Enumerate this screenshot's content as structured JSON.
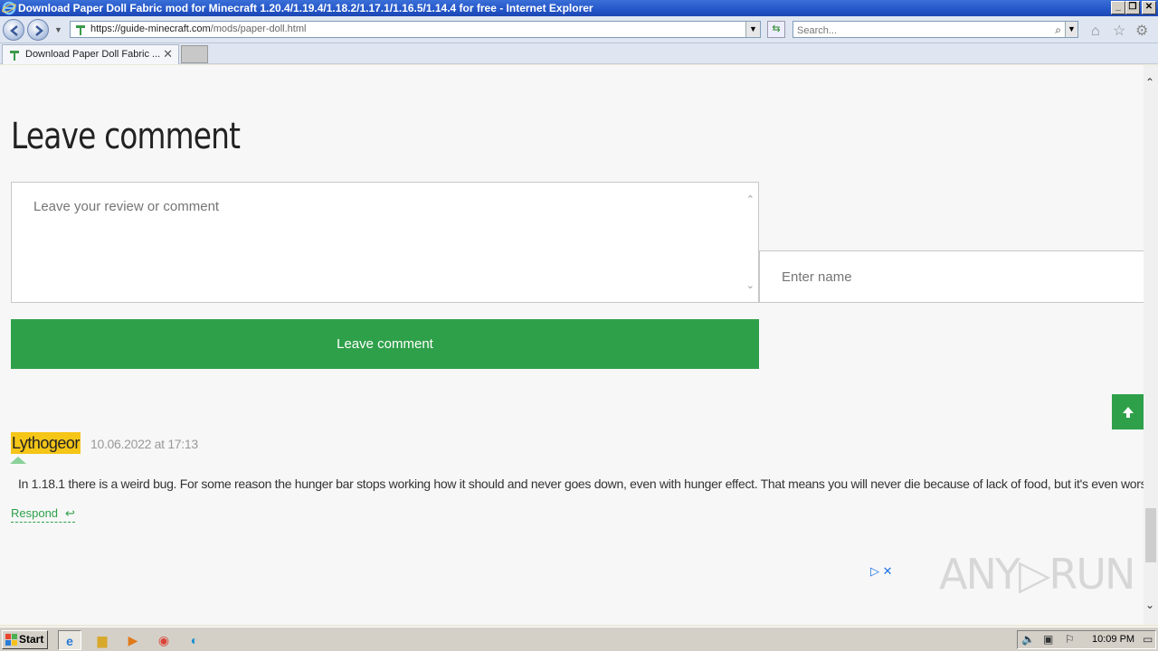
{
  "window": {
    "title": "Download Paper Doll Fabric mod for Minecraft 1.20.4/1.19.4/1.18.2/1.17.1/1.16.5/1.14.4 for free - Internet Explorer",
    "min": "_",
    "max": "❐",
    "close": "✕"
  },
  "address": {
    "url_host": "https://guide-minecraft.com",
    "url_path": "/mods/paper-doll.html",
    "search_placeholder": "Search..."
  },
  "tabs": [
    {
      "label": "Download Paper Doll Fabric ...",
      "close": "✕"
    }
  ],
  "page": {
    "heading": "Leave comment",
    "comment_placeholder": "Leave your review or comment",
    "name_placeholder": "Enter name",
    "submit_label": "Leave comment",
    "comment": {
      "author": "Lythogeor",
      "date": "10.06.2022 at 17:13",
      "text": "In 1.18.1 there is a weird bug. For some reason the hunger bar stops working how it should and never goes down, even with hunger effect. That means you will never die because of lack of food, but it's even worse",
      "respond_label": "Respond"
    },
    "watermark": "ANY▷RUN"
  },
  "taskbar": {
    "start_label": "Start",
    "clock": "10:09 PM"
  },
  "colors": {
    "accent_green": "#2fa04a",
    "author_badge": "#f5c518",
    "titlebar": "#2456c8"
  }
}
